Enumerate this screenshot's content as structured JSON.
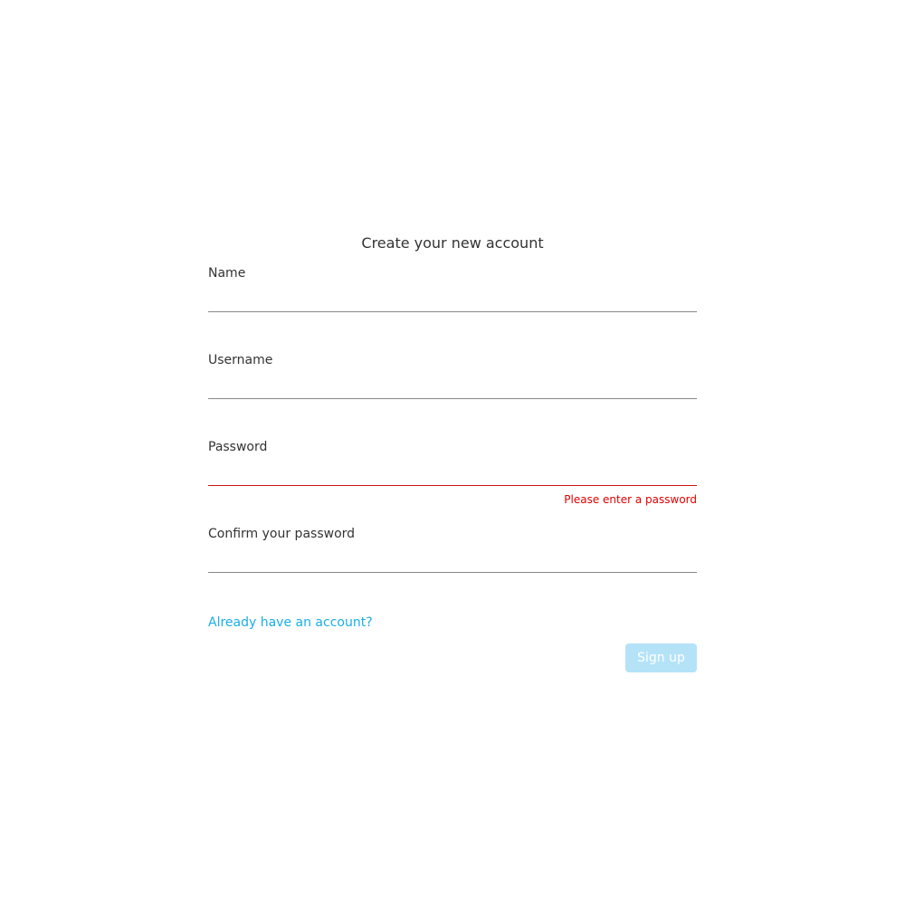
{
  "form": {
    "title": "Create your new account",
    "fields": [
      {
        "label": "Name",
        "value": "",
        "placeholder": ""
      },
      {
        "label": "Username",
        "value": "",
        "placeholder": ""
      },
      {
        "label": "Password",
        "value": "",
        "placeholder": "",
        "error": "Please enter a password"
      },
      {
        "label": "Confirm your password",
        "value": "",
        "placeholder": ""
      }
    ],
    "login_link": "Already have an account?",
    "submit_label": "Sign up"
  },
  "colors": {
    "link": "#1aaee6",
    "error": "#e00000",
    "button_disabled_bg": "#b4e3f8"
  }
}
